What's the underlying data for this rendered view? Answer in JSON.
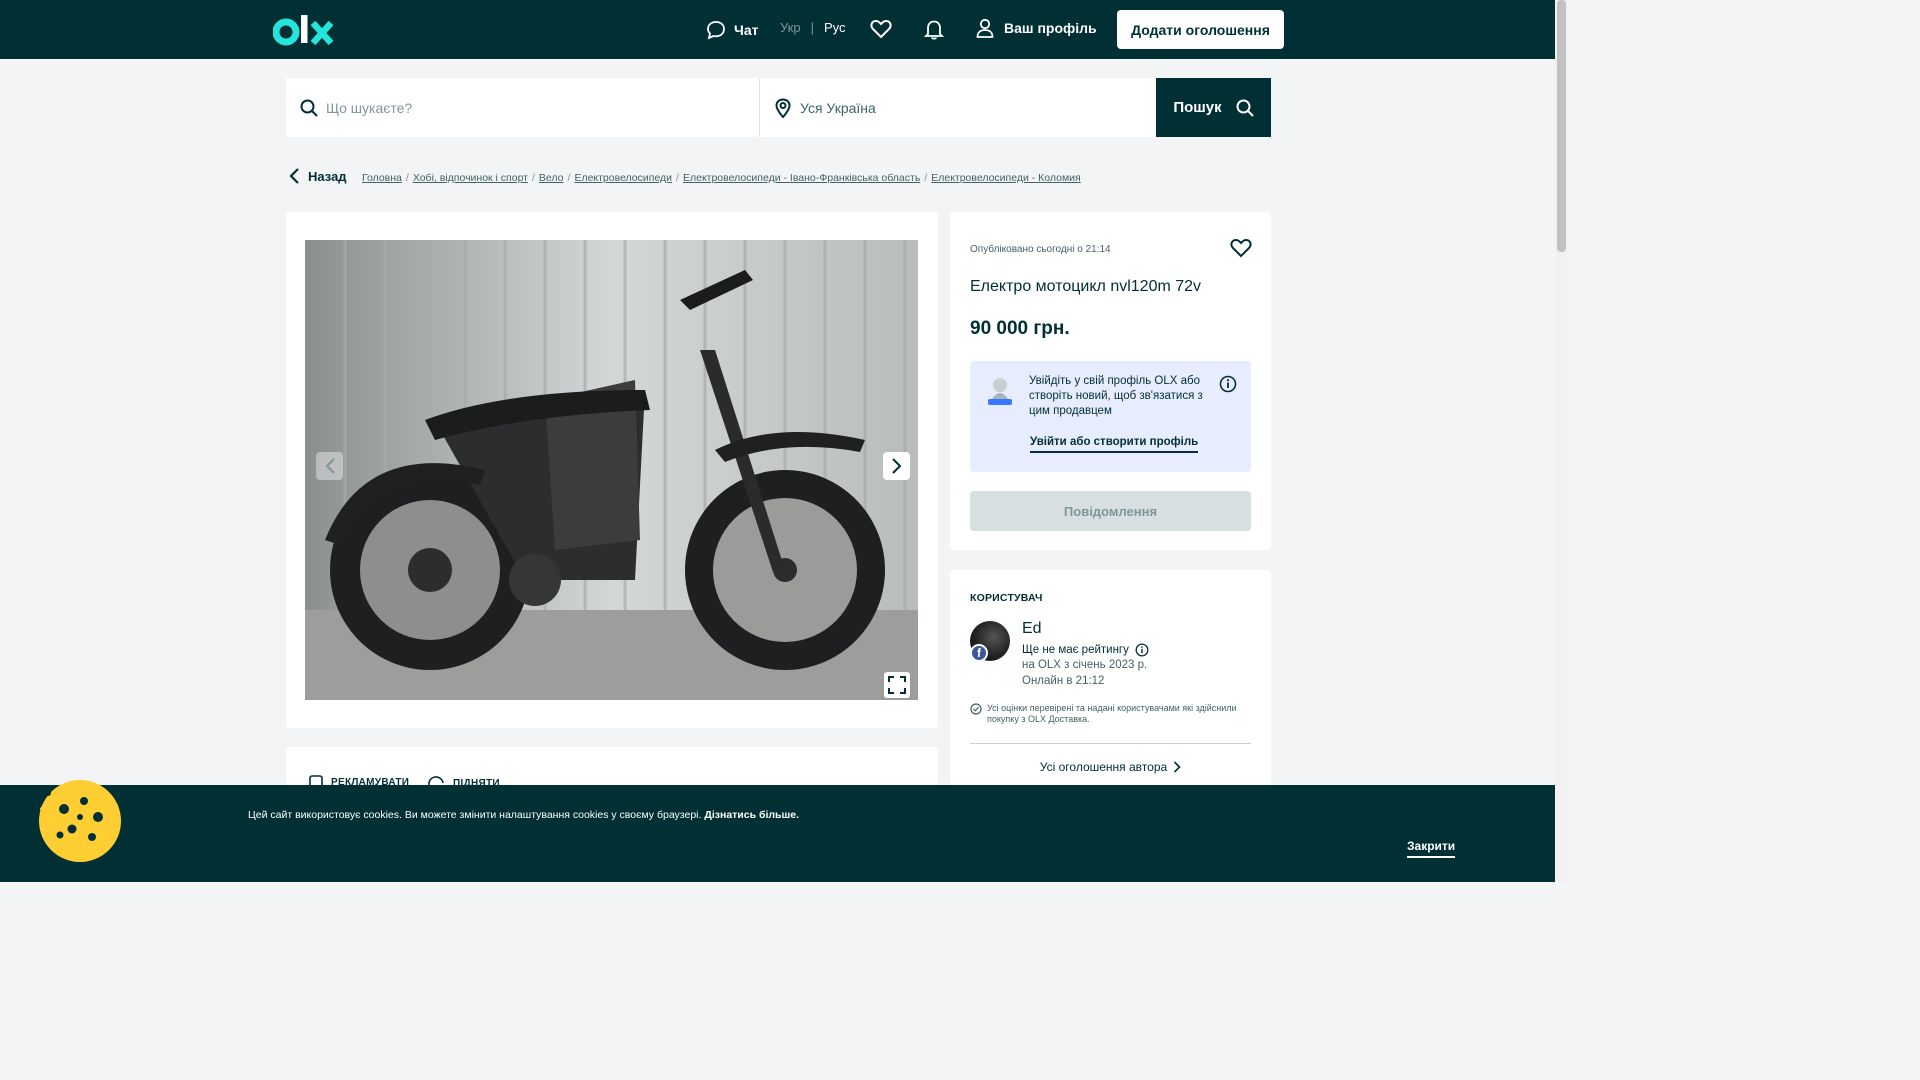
{
  "header": {
    "chat_label": "Чат",
    "lang_ukr": "Укр",
    "lang_sep": "|",
    "lang_rus": "Рус",
    "profile_label": "Ваш профіль",
    "add_button": "Додати оголошення"
  },
  "search": {
    "query_placeholder": "Що шукаєте?",
    "location_value": "Уся Україна",
    "button_label": "Пошук"
  },
  "breadcrumbs": {
    "back_label": "Назад",
    "items": [
      "Головна",
      "Хобі, відпочинок і спорт",
      "Вело",
      "Електровелосипеди",
      "Електровелосипеди - Івано-Франківська область",
      "Електровелосипеди - Коломия"
    ],
    "separator": "/"
  },
  "gallery": {
    "photo_icon": "motorbike-photo"
  },
  "actions": {
    "promote_label": "РЕКЛАМУВАТИ",
    "raise_label": "ПІДНЯТИ"
  },
  "ad": {
    "posted": "Опубліковано сьогодні о 21:14",
    "title": "Електро мотоцикл nvl120m 72v",
    "price": "90 000 грн.",
    "login_prompt": "Увійдіть у свій профіль OLX або створіть новий, щоб зв'язатися з цим продавцем",
    "login_link": "Увійти або створити профіль",
    "message_button": "Повідомлення"
  },
  "user": {
    "heading": "КОРИСТУВАЧ",
    "name": "Ed",
    "rating": "Ще не має рейтингу",
    "since": "на OLX з січень 2023 р.",
    "online": "Онлайн в 21:12",
    "verified_note": "Усі оцінки перевірені та надані користувачами які здійснили покупку з OLX Доставка.",
    "all_ads": "Усі оголошення автора"
  },
  "cookie": {
    "text": "Цей сайт використовує cookies. Ви можете змінити налаштування cookies у своєму браузері.",
    "learn_more": "Дізнатись більше.",
    "close": "Закрити"
  },
  "colors": {
    "brand_dark": "#002f34",
    "brand_teal": "#23e5db",
    "brand_yellow": "#ffce32",
    "login_box": "#e8ecff"
  }
}
